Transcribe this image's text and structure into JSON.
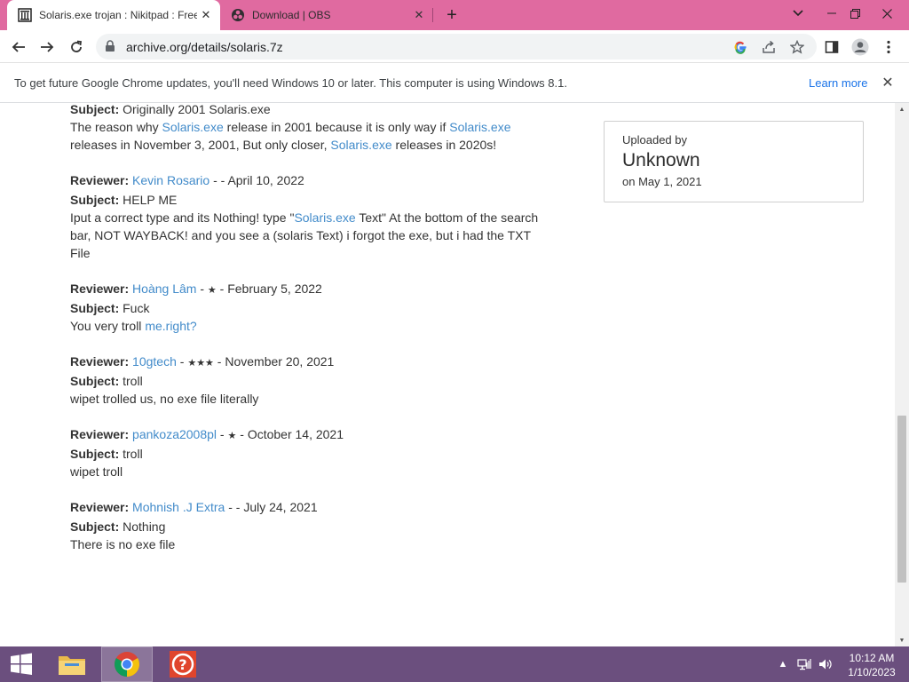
{
  "browser": {
    "tabs": [
      {
        "title": "Solaris.exe trojan : Nikitpad : Free",
        "favicon": "archive-icon",
        "active": true
      },
      {
        "title": "Download | OBS",
        "favicon": "obs-icon",
        "active": false
      }
    ],
    "new_tab_label": "+",
    "url": "archive.org/details/solaris.7z",
    "accent": "#e06aa0"
  },
  "infobar": {
    "message": "To get future Google Chrome updates, you'll need Windows 10 or later. This computer is using Windows 8.1.",
    "learn_more": "Learn more"
  },
  "page": {
    "labels": {
      "reviewer": "Reviewer:",
      "subject": "Subject:"
    },
    "first_review": {
      "subject": "Originally 2001 Solaris.exe",
      "body": [
        {
          "t": "The reason why ",
          "link": false
        },
        {
          "t": "Solaris.exe",
          "link": true
        },
        {
          "t": " release in 2001 because it is only way if ",
          "link": false
        },
        {
          "t": "Solaris.exe",
          "link": true
        },
        {
          "t": " releases in November 3, 2001, But only closer, ",
          "link": false
        },
        {
          "t": "Solaris.exe",
          "link": true
        },
        {
          "t": " releases in 2020s!",
          "link": false
        }
      ]
    },
    "reviews": [
      {
        "reviewer": "Kevin Rosario",
        "stars": "",
        "date": "April 10, 2022",
        "subject": "HELP ME",
        "body": [
          {
            "t": "Iput a correct type and its Nothing! type \"",
            "link": false
          },
          {
            "t": "Solaris.exe",
            "link": true
          },
          {
            "t": " Text\" At the bottom of the search bar, NOT WAYBACK! and you see a (solaris Text) i forgot the exe, but i had the TXT File",
            "link": false
          }
        ]
      },
      {
        "reviewer": "Hoàng Lâm",
        "stars": "★",
        "date": "February 5, 2022",
        "subject": "Fuck",
        "body": [
          {
            "t": "You very troll ",
            "link": false
          },
          {
            "t": "me.right?",
            "link": true
          }
        ]
      },
      {
        "reviewer": "10gtech",
        "stars": "★★★",
        "date": "November 20, 2021",
        "subject": "troll",
        "body": [
          {
            "t": "wipet trolled us, no exe file literally",
            "link": false
          }
        ]
      },
      {
        "reviewer": "pankoza2008pl",
        "stars": "★",
        "date": "October 14, 2021",
        "subject": "troll",
        "body": [
          {
            "t": "wipet troll",
            "link": false
          }
        ]
      },
      {
        "reviewer": "Mohnish .J Extra",
        "stars": "",
        "date": "July 24, 2021",
        "subject": "Nothing",
        "body": [
          {
            "t": "There is no exe file",
            "link": false
          }
        ]
      }
    ],
    "upload": {
      "label": "Uploaded by",
      "name": "Unknown",
      "date": "on May 1, 2021"
    }
  },
  "taskbar": {
    "time": "10:12 AM",
    "date": "1/10/2023",
    "apps": [
      "file-explorer-icon",
      "chrome-icon",
      "help-icon"
    ]
  }
}
